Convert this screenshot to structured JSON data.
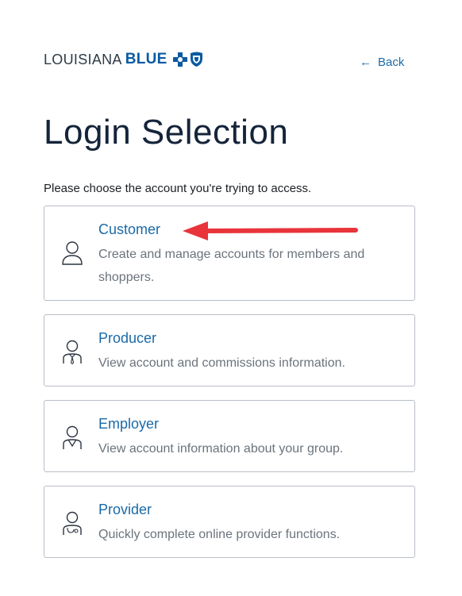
{
  "header": {
    "logo_light": "LOUISIANA",
    "logo_bold": "BLUE",
    "logo_marks": [
      "cross-icon",
      "shield-icon"
    ],
    "back_label": "Back",
    "back_icon": "arrow-left-icon"
  },
  "main": {
    "title": "Login Selection",
    "instruction": "Please choose the account you're trying to access.",
    "cards": [
      {
        "title": "Customer",
        "description": "Create and manage accounts for members and shoppers.",
        "icon": "person-icon"
      },
      {
        "title": "Producer",
        "description": "View account and commissions information.",
        "icon": "person-tie-icon"
      },
      {
        "title": "Employer",
        "description": "View account information about your group.",
        "icon": "person-vneck-icon"
      },
      {
        "title": "Provider",
        "description": "Quickly complete online provider functions.",
        "icon": "person-stethoscope-icon"
      }
    ]
  },
  "colors": {
    "brand_blue": "#0b5aa2",
    "link_blue": "#1a6aa8",
    "title_navy": "#14243a",
    "annotation_red": "#e8343a",
    "card_border": "#b8bec6"
  }
}
